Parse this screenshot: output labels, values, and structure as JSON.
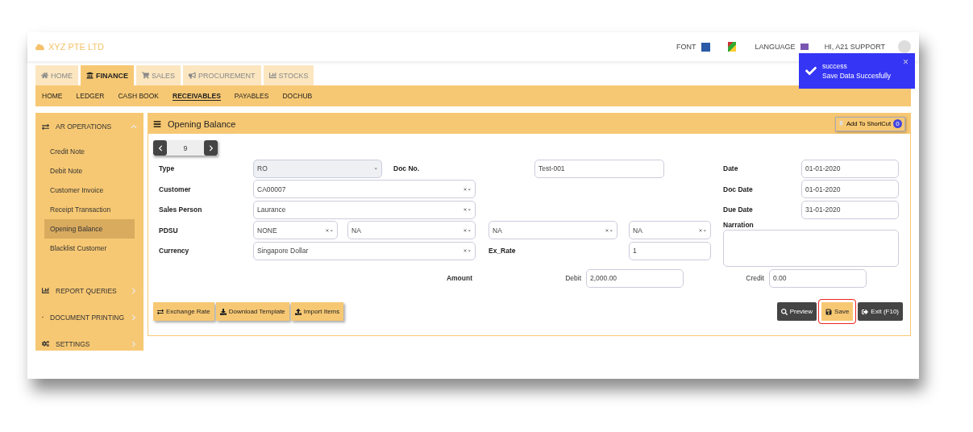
{
  "header": {
    "company": "XYZ PTE LTD",
    "font_label": "FONT",
    "language_label": "LANGUAGE",
    "user": "HI, A21 SUPPORT"
  },
  "toast": {
    "title": "success",
    "message": "Save Data Succesfully",
    "close": "×"
  },
  "module_tabs": [
    {
      "label": "HOME",
      "selected": false
    },
    {
      "label": "FINANCE",
      "selected": true
    },
    {
      "label": "SALES",
      "selected": false
    },
    {
      "label": "PROCUREMENT",
      "selected": false
    },
    {
      "label": "STOCKS",
      "selected": false
    }
  ],
  "sub_menu": [
    {
      "label": "HOME",
      "selected": false
    },
    {
      "label": "LEDGER",
      "selected": false
    },
    {
      "label": "CASH BOOK",
      "selected": false
    },
    {
      "label": "RECEIVABLES",
      "selected": true
    },
    {
      "label": "PAYABLES",
      "selected": false
    },
    {
      "label": "DOCHUB",
      "selected": false
    }
  ],
  "sidebar": {
    "sections": [
      {
        "label": "AR OPERATIONS",
        "expanded": true,
        "children": [
          {
            "label": "Credit Note",
            "selected": false
          },
          {
            "label": "Debit Note",
            "selected": false
          },
          {
            "label": "Customer Invoice",
            "selected": false
          },
          {
            "label": "Receipt Transaction",
            "selected": false
          },
          {
            "label": "Opening Balance",
            "selected": true
          },
          {
            "label": "Blacklist Customer",
            "selected": false
          }
        ]
      },
      {
        "label": "REPORT QUERIES",
        "expanded": false
      },
      {
        "label": "DOCUMENT PRINTING",
        "expanded": false
      },
      {
        "label": "SETTINGS",
        "expanded": false
      }
    ]
  },
  "panel": {
    "title": "Opening Balance",
    "shortcut_button": "Add To ShortCut",
    "shortcut_count": "0",
    "record_number": "9",
    "type": {
      "label": "Type",
      "value": "RO"
    },
    "doc_no": {
      "label": "Doc No.",
      "value": "Test-001"
    },
    "customer": {
      "label": "Customer",
      "value": "CA00007"
    },
    "sales_person": {
      "label": "Sales Person",
      "value": "Laurance"
    },
    "pdsu": {
      "label": "PDSU",
      "values": [
        "NONE",
        "NA",
        "NA",
        "NA"
      ]
    },
    "currency": {
      "label": "Currency",
      "value": "Singapore Dollar"
    },
    "ex_rate": {
      "label": "Ex_Rate",
      "value": "1"
    },
    "dates": [
      {
        "label": "Date",
        "value": "01-01-2020"
      },
      {
        "label": "Doc Date",
        "value": "01-01-2020"
      },
      {
        "label": "Due Date",
        "value": "31-01-2020"
      }
    ],
    "narration": {
      "label": "Narration"
    },
    "amount": {
      "label": "Amount",
      "debit_label": "Debit",
      "debit": "2,000.00",
      "credit_label": "Credit",
      "credit": "0.00"
    },
    "left_buttons": [
      {
        "label": "Exchange Rate"
      },
      {
        "label": "Download Template"
      },
      {
        "label": "Import Items"
      }
    ],
    "right_buttons": [
      {
        "label": "Preview",
        "kind": "dark",
        "selected": false
      },
      {
        "label": "Save",
        "kind": "light",
        "selected": true
      },
      {
        "label": "Exit (F10)",
        "kind": "dark",
        "selected": false
      }
    ]
  }
}
